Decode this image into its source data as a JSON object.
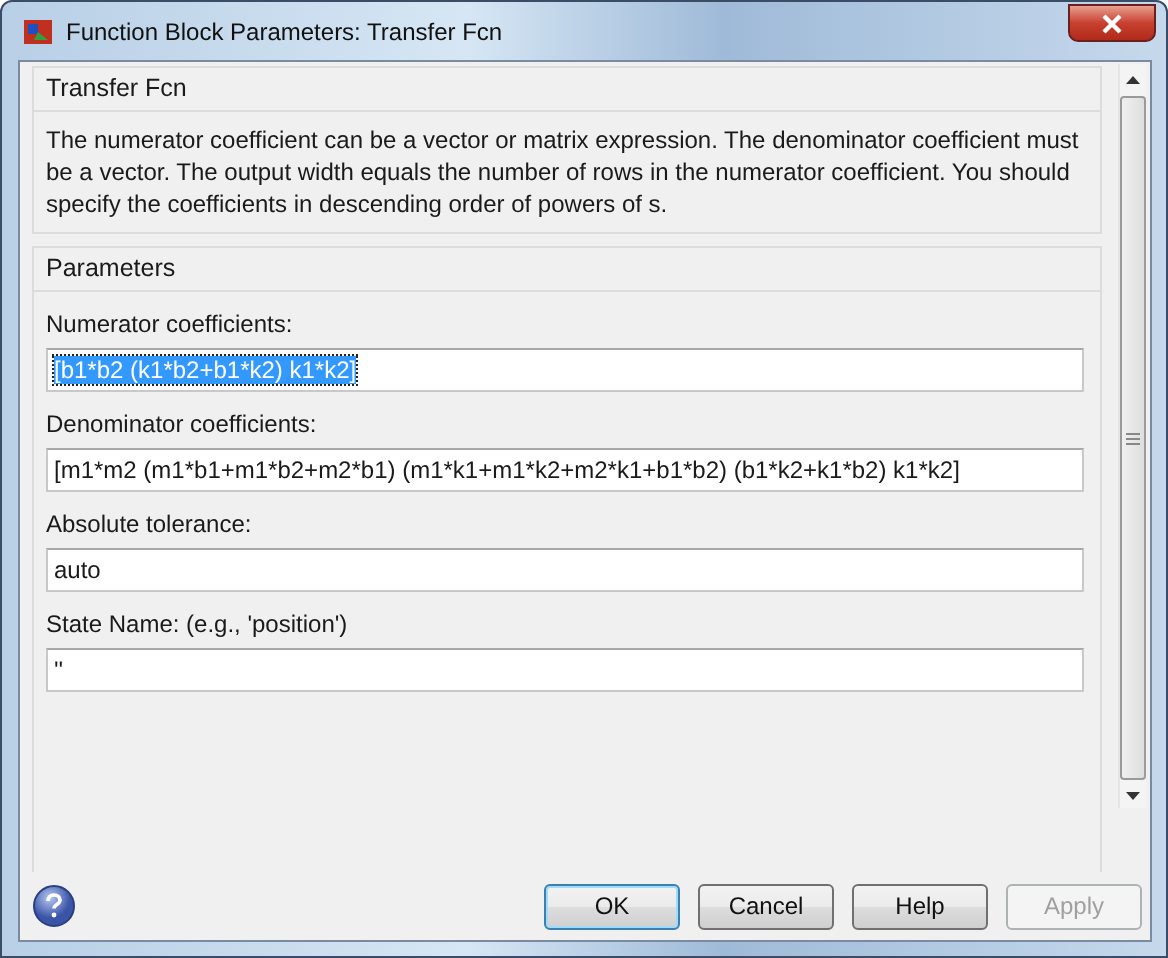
{
  "window": {
    "title": "Function Block Parameters: Transfer Fcn"
  },
  "description": {
    "heading": "Transfer Fcn",
    "text": "The numerator coefficient can be a vector or matrix expression. The denominator coefficient must be a vector. The output width equals the number of rows in the numerator coefficient. You should specify the coefficients in descending order of powers of s."
  },
  "parameters": {
    "heading": "Parameters",
    "fields": [
      {
        "label": "Numerator coefficients:",
        "value": "[b1*b2 (k1*b2+b1*k2) k1*k2]",
        "selected": true
      },
      {
        "label": "Denominator coefficients:",
        "value": "[m1*m2 (m1*b1+m1*b2+m2*b1) (m1*k1+m1*k2+m2*k1+b1*b2) (b1*k2+k1*b2) k1*k2]",
        "selected": false
      },
      {
        "label": "Absolute tolerance:",
        "value": "auto",
        "selected": false
      },
      {
        "label": "State Name: (e.g., 'position')",
        "value": "''",
        "selected": false
      }
    ]
  },
  "buttons": [
    {
      "label": "OK",
      "default": true,
      "disabled": false
    },
    {
      "label": "Cancel",
      "default": false,
      "disabled": false
    },
    {
      "label": "Help",
      "default": false,
      "disabled": false
    },
    {
      "label": "Apply",
      "default": false,
      "disabled": true
    }
  ]
}
